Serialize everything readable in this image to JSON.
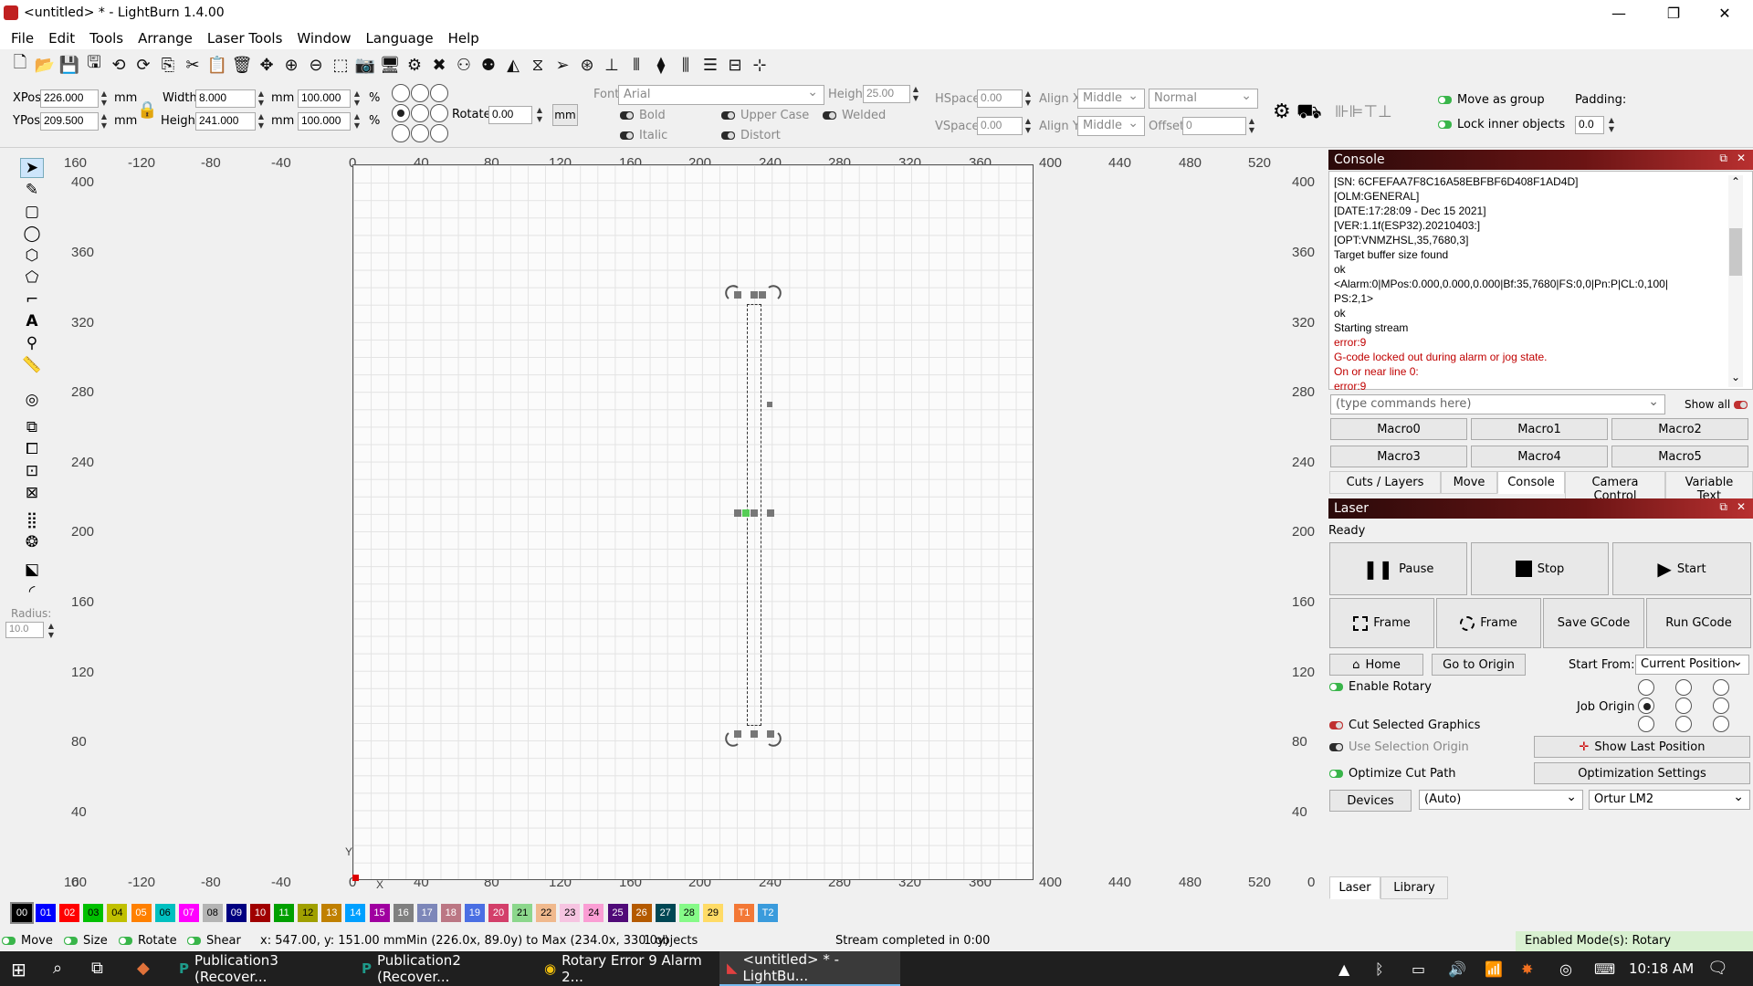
{
  "window": {
    "title": "<untitled> * - LightBurn 1.4.00"
  },
  "menu": [
    "File",
    "Edit",
    "Tools",
    "Arrange",
    "Laser Tools",
    "Window",
    "Language",
    "Help"
  ],
  "props": {
    "xpos_label": "XPos",
    "xpos": "226.000",
    "ypos_label": "YPos",
    "ypos": "209.500",
    "unit": "mm",
    "width_label": "Width",
    "width": "8.000",
    "height_label": "Height",
    "height": "241.000",
    "wpct": "100.000",
    "hpct": "100.000",
    "pct": "%",
    "rotate_label": "Rotate",
    "rotate": "0.00",
    "rot_unit": "mm",
    "font_label": "Font",
    "font": "Arial",
    "fheight_label": "Height",
    "fheight": "25.00",
    "hspace_label": "HSpace",
    "hspace": "0.00",
    "vspace_label": "VSpace",
    "vspace": "0.00",
    "alignx_label": "Align X",
    "alignx": "Middle",
    "aligny_label": "Align Y",
    "aligny": "Middle",
    "mode": "Normal",
    "offset_label": "Offset",
    "offset": "0",
    "bold": "Bold",
    "italic": "Italic",
    "uppercase": "Upper Case",
    "distort": "Distort",
    "welded": "Welded",
    "move_group": "Move as group",
    "lock_inner": "Lock inner objects",
    "padding_label": "Padding:",
    "padding": "0.0"
  },
  "left": {
    "radius_label": "Radius:",
    "radius": "10.0"
  },
  "rulers": {
    "top": [
      "160",
      "-120",
      "-80",
      "-40",
      "0",
      "40",
      "80",
      "120",
      "160",
      "200",
      "240",
      "280",
      "320",
      "360",
      "400",
      "440",
      "480",
      "520"
    ],
    "left": [
      "400",
      "360",
      "320",
      "280",
      "240",
      "200",
      "160",
      "120",
      "80",
      "40",
      "0"
    ],
    "bottom": [
      "160",
      "-120",
      "-80",
      "-40",
      "0",
      "40",
      "80",
      "120",
      "160",
      "200",
      "240",
      "280",
      "320",
      "360",
      "400",
      "440",
      "480",
      "520"
    ],
    "right": [
      "400",
      "360",
      "320",
      "280",
      "240",
      "200",
      "160",
      "120",
      "80",
      "40",
      "0"
    ],
    "x_axis": "X",
    "y_axis": "Y"
  },
  "console": {
    "title": "Console",
    "lines": [
      {
        "t": "[SN: 6CFEFAA7F8C16A58EBFBF6D408F1AD4D]",
        "e": false
      },
      {
        "t": "[OLM:GENERAL]",
        "e": false
      },
      {
        "t": "[DATE:17:28:09 - Dec 15 2021]",
        "e": false
      },
      {
        "t": "[VER:1.1f(ESP32).20210403:]",
        "e": false
      },
      {
        "t": "[OPT:VNMZHSL,35,7680,3]",
        "e": false
      },
      {
        "t": "Target buffer size found",
        "e": false
      },
      {
        "t": "ok",
        "e": false
      },
      {
        "t": "<Alarm:0|MPos:0.000,0.000,0.000|Bf:35,7680|FS:0,0|Pn:P|CL:0,100|",
        "e": false
      },
      {
        "t": "PS:2,1>",
        "e": false
      },
      {
        "t": "ok",
        "e": false
      },
      {
        "t": "Starting stream",
        "e": false
      },
      {
        "t": "error:9",
        "e": true
      },
      {
        "t": "G-code locked out during alarm or jog state.",
        "e": true
      },
      {
        "t": "On or near line 0:",
        "e": true
      },
      {
        "t": "error:9",
        "e": true
      }
    ],
    "input_placeholder": "(type commands here)",
    "show_all": "Show all",
    "macros": [
      "Macro0",
      "Macro1",
      "Macro2",
      "Macro3",
      "Macro4",
      "Macro5"
    ],
    "tabs": [
      "Cuts / Layers",
      "Move",
      "Console",
      "Camera Control",
      "Variable Text"
    ]
  },
  "laser": {
    "title": "Laser",
    "status": "Ready",
    "pause": "Pause",
    "stop": "Stop",
    "start": "Start",
    "frame1": "Frame",
    "frame2": "Frame",
    "save_gcode": "Save GCode",
    "run_gcode": "Run GCode",
    "home": "Home",
    "go_origin": "Go to Origin",
    "start_from_label": "Start From:",
    "start_from": "Current Position",
    "enable_rotary": "Enable Rotary",
    "job_origin": "Job Origin",
    "cut_selected": "Cut Selected Graphics",
    "use_selection": "Use Selection Origin",
    "optimize": "Optimize Cut Path",
    "show_last": "Show Last Position",
    "opt_settings": "Optimization Settings",
    "devices": "Devices",
    "auto": "(Auto)",
    "device": "Ortur LM2",
    "tabs": [
      "Laser",
      "Library"
    ]
  },
  "palette": [
    {
      "l": "00",
      "c": "#000000"
    },
    {
      "l": "01",
      "c": "#0000ff"
    },
    {
      "l": "02",
      "c": "#ff0000"
    },
    {
      "l": "03",
      "c": "#00c000"
    },
    {
      "l": "04",
      "c": "#c0c000"
    },
    {
      "l": "05",
      "c": "#ff8000"
    },
    {
      "l": "06",
      "c": "#00c0c0"
    },
    {
      "l": "07",
      "c": "#ff00ff"
    },
    {
      "l": "08",
      "c": "#b4b4b4"
    },
    {
      "l": "09",
      "c": "#000080"
    },
    {
      "l": "10",
      "c": "#a00000"
    },
    {
      "l": "11",
      "c": "#00a000"
    },
    {
      "l": "12",
      "c": "#a0a000"
    },
    {
      "l": "13",
      "c": "#c08000"
    },
    {
      "l": "14",
      "c": "#00a0ff"
    },
    {
      "l": "15",
      "c": "#a000a0"
    },
    {
      "l": "16",
      "c": "#808080"
    },
    {
      "l": "17",
      "c": "#7d87b9"
    },
    {
      "l": "18",
      "c": "#bb7784"
    },
    {
      "l": "19",
      "c": "#4a6fe3"
    },
    {
      "l": "20",
      "c": "#d33f6a"
    },
    {
      "l": "21",
      "c": "#8cd78c"
    },
    {
      "l": "22",
      "c": "#f0b98d"
    },
    {
      "l": "23",
      "c": "#f6c4e1"
    },
    {
      "l": "24",
      "c": "#fa9ed4"
    },
    {
      "l": "25",
      "c": "#500a78"
    },
    {
      "l": "26",
      "c": "#b45a00"
    },
    {
      "l": "27",
      "c": "#004754"
    },
    {
      "l": "28",
      "c": "#86fa88"
    },
    {
      "l": "29",
      "c": "#ffdb66"
    },
    {
      "l": "T1",
      "c": "#f37836"
    },
    {
      "l": "T2",
      "c": "#3a9bdc"
    }
  ],
  "status": {
    "move": "Move",
    "size": "Size",
    "rotate": "Rotate",
    "shear": "Shear",
    "coords": "x: 547.00, y: 151.00 mm",
    "minmax": "Min (226.0x, 89.0y) to Max (234.0x, 330.0y)",
    "objects": "1 objects",
    "stream": "Stream completed in 0:00",
    "modes": "Enabled Mode(s): Rotary"
  },
  "taskbar": {
    "items": [
      "Publication3 (Recover...",
      "Publication2 (Recover...",
      "Rotary Error 9 Alarm 2...",
      "<untitled> * - LightBu..."
    ],
    "time": "10:18 AM"
  }
}
